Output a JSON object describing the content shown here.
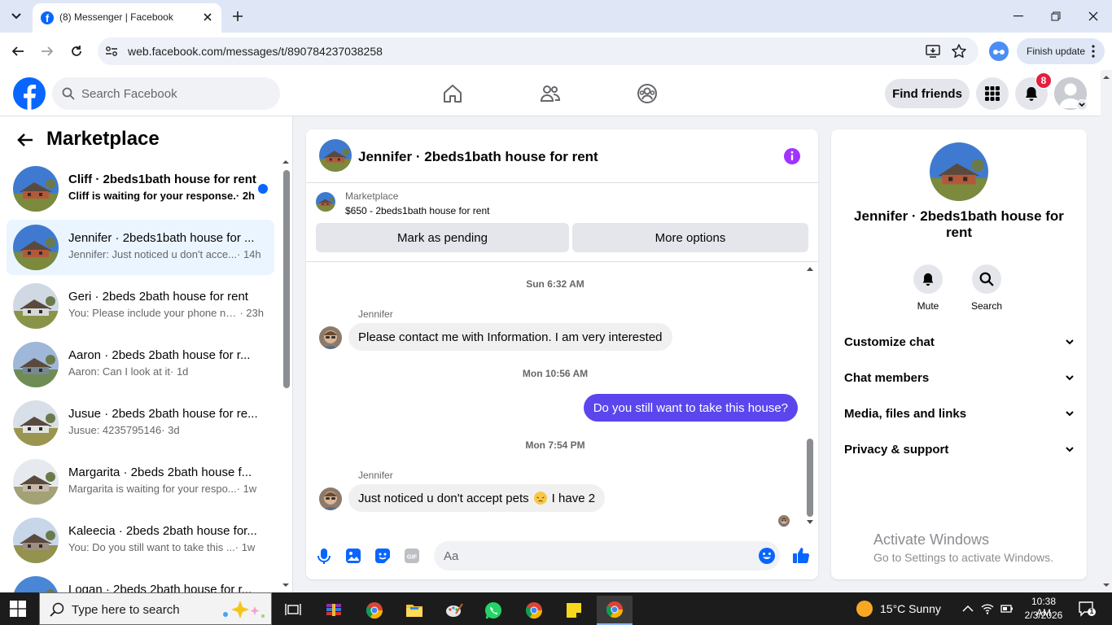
{
  "browser": {
    "tab_title": "(8) Messenger | Facebook",
    "url": "web.facebook.com/messages/t/890784237038258",
    "finish_update": "Finish update"
  },
  "header": {
    "search_placeholder": "Search Facebook",
    "find_friends": "Find friends",
    "notification_count": "8"
  },
  "chat_list": {
    "title": "Marketplace",
    "items": [
      {
        "name": "Cliff · 2beds1bath house for rent",
        "snippet": "Cliff is waiting for your response.",
        "time": " · 2h",
        "unread": true,
        "active": false
      },
      {
        "name": "Jennifer · 2beds1bath house for ...",
        "snippet": "Jennifer: Just noticed u don't acce...",
        "time": " · 14h",
        "unread": false,
        "active": true
      },
      {
        "name": "Geri · 2beds 2bath house for rent",
        "snippet": "You: Please include your phone nu...",
        "time": " · 23h",
        "unread": false,
        "active": false
      },
      {
        "name": "Aaron · 2beds 2bath house for r...",
        "snippet": "Aaron: Can I look at it",
        "time": " · 1d",
        "unread": false,
        "active": false
      },
      {
        "name": "Jusue · 2beds 2bath house for re...",
        "snippet": "Jusue: 4235795146",
        "time": " · 3d",
        "unread": false,
        "active": false
      },
      {
        "name": "Margarita · 2beds 2bath house f...",
        "snippet": "Margarita is waiting for your respo...",
        "time": " · 1w",
        "unread": false,
        "active": false
      },
      {
        "name": "Kaleecia · 2beds 2bath house for...",
        "snippet": "You: Do you still want to take this ...",
        "time": " · 1w",
        "unread": false,
        "active": false
      },
      {
        "name": "Logan · 2beds 2bath house for r...",
        "snippet": "",
        "time": "",
        "unread": false,
        "active": false
      }
    ]
  },
  "chat": {
    "title": "Jennifer · 2beds1bath house for rent",
    "marketplace_label": "Marketplace",
    "listing": "$650 - 2beds1bath house for rent",
    "mark_pending": "Mark as pending",
    "more_options": "More options",
    "messages": {
      "ts1": "Sun 6:32 AM",
      "sender1": "Jennifer",
      "msg1": "Please contact me with Information. I am very interested",
      "ts2": "Mon 10:56 AM",
      "msg2": "Do you still want to take this house?",
      "ts3": "Mon 7:54 PM",
      "sender3": "Jennifer",
      "msg3a": "Just noticed u don't accept pets",
      "msg3b": "I have 2"
    },
    "input_placeholder": "Aa"
  },
  "info_panel": {
    "title": "Jennifer · 2beds1bath house for rent",
    "mute": "Mute",
    "search": "Search",
    "sections": [
      "Customize chat",
      "Chat members",
      "Media, files and links",
      "Privacy & support"
    ],
    "activate_title": "Activate Windows",
    "activate_sub": "Go to Settings to activate Windows."
  },
  "taskbar": {
    "search_text": "Type here to search",
    "weather": "15°C  Sunny",
    "time": "10:38 AM",
    "date": "2/3/2026",
    "notif_count": "1"
  },
  "colors": {
    "fb_blue": "#0866ff",
    "outgoing_bubble": "#5b46ee",
    "badge_red": "#e41e3f",
    "info_purple": "#a033ff"
  }
}
